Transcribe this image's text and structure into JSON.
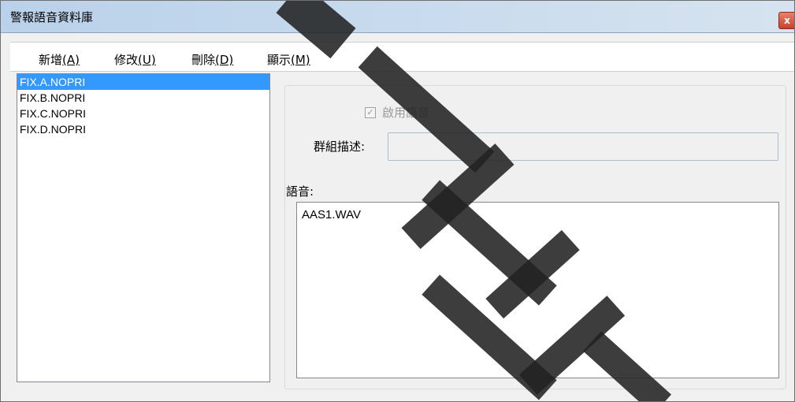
{
  "window": {
    "title": "警報語音資料庫",
    "close_label": "x"
  },
  "menu": {
    "items": [
      {
        "label": "新增",
        "mnemonic": "(A)"
      },
      {
        "label": "修改",
        "mnemonic": "(U)"
      },
      {
        "label": "刪除",
        "mnemonic": "(D)"
      },
      {
        "label": "顯示",
        "mnemonic": "(M)"
      }
    ]
  },
  "left_list": {
    "items": [
      "FIX.A.NOPRI",
      "FIX.B.NOPRI",
      "FIX.C.NOPRI",
      "FIX.D.NOPRI"
    ],
    "selected_index": 0
  },
  "panel": {
    "enable_voice_label": "啟用語音",
    "enable_voice_checked": true,
    "group_desc_label": "群組描述:",
    "group_desc_value": "",
    "voice_label": "語音:",
    "voice_items": [
      "AAS1.WAV"
    ]
  },
  "colors": {
    "selection": "#3399ff",
    "titlebar": "#b9d1ea",
    "close_button": "#c5432c"
  }
}
